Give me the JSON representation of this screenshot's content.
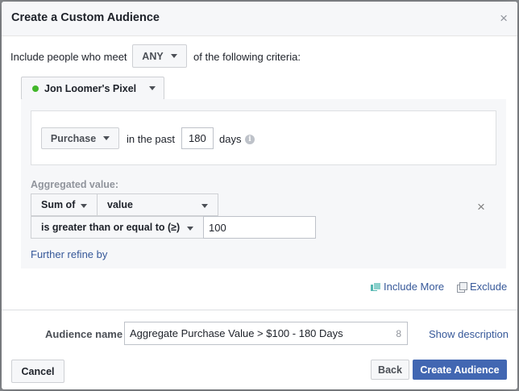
{
  "dialog": {
    "title": "Create a Custom Audience",
    "close_glyph": "×"
  },
  "criteria": {
    "prefix": "Include people who meet",
    "match_value": "ANY",
    "suffix": "of the following criteria:"
  },
  "pixel": {
    "name": "Jon Loomer's Pixel",
    "status_color": "#42b72a"
  },
  "rule": {
    "event": "Purchase",
    "in_the_past_label": "in the past",
    "days_value": "180",
    "days_label": "days",
    "info_glyph": "i"
  },
  "aggregated": {
    "label": "Aggregated value:",
    "function": "Sum of",
    "parameter": "value",
    "operator": "is greater than or equal to (≥)",
    "amount": "100",
    "remove_glyph": "×"
  },
  "refine_link": "Further refine by",
  "actions": {
    "include_more": "Include More",
    "exclude": "Exclude"
  },
  "audience": {
    "name_label": "Audience name",
    "name_value": "Aggregate Purchase Value > $100 - 180 Days",
    "remaining_chars": "8",
    "show_description": "Show description"
  },
  "footer": {
    "cancel": "Cancel",
    "back": "Back",
    "create": "Create Audience"
  },
  "colors": {
    "primary": "#4267b2",
    "link": "#365899",
    "include_icon": "#52b6b0"
  }
}
